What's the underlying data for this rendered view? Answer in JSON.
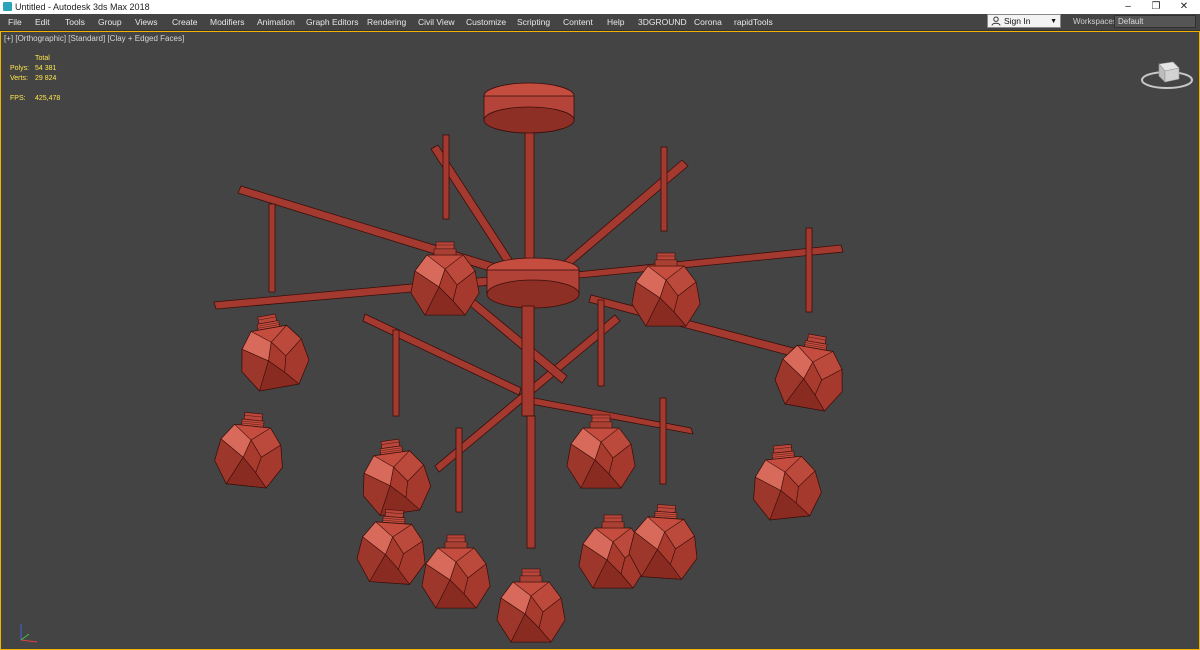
{
  "window": {
    "title": "Untitled - Autodesk 3ds Max 2018",
    "controls": {
      "minimize": "–",
      "restore": "❐",
      "close": "✕"
    }
  },
  "menu": [
    "File",
    "Edit",
    "Tools",
    "Group",
    "Views",
    "Create",
    "Modifiers",
    "Animation",
    "Graph Editors",
    "Rendering",
    "Civil View",
    "Customize",
    "Scripting",
    "Content",
    "Help",
    "3DGROUND",
    "Corona",
    "rapidTools"
  ],
  "account": {
    "signin_label": "Sign In",
    "dropdown_icon": "▼"
  },
  "workspaces": {
    "label": "Workspaces:",
    "value": "Default"
  },
  "viewport": {
    "label_parts": [
      "[+]",
      "[Orthographic]",
      "[Standard]",
      "[Clay + Edged Faces]"
    ],
    "stats": {
      "total_label": "Total",
      "polys_label": "Polys:",
      "polys_value": "54 381",
      "verts_label": "Verts:",
      "verts_value": "29 824",
      "fps_label": "FPS:",
      "fps_value": "425,478"
    }
  },
  "colors": {
    "viewport_bg": "#444444",
    "active_border": "#f2b400",
    "clay": "#c44d3f",
    "clay_light": "#d76a5a",
    "clay_dark": "#8a2b22",
    "edge": "#3a0e0a",
    "stats_text": "#ffe84a"
  },
  "icons": {
    "app": "3ds-max-icon",
    "user": "user-icon",
    "viewcube": "viewcube-icon",
    "axis": "axis-tripod-icon"
  }
}
